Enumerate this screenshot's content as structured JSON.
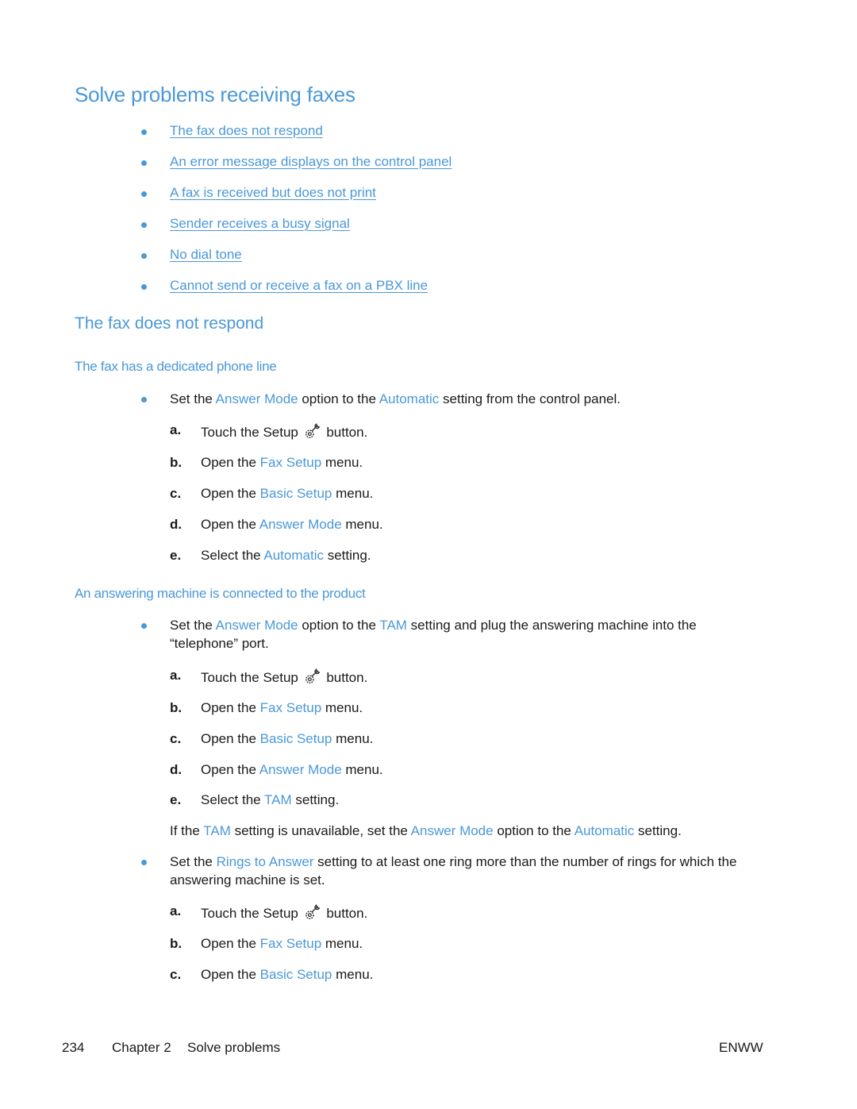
{
  "title": "Solve problems receiving faxes",
  "toc": [
    "The fax does not respond",
    "An error message displays on the control panel",
    "A fax is received but does not print",
    "Sender receives a busy signal",
    "No dial tone",
    "Cannot send or receive a fax on a PBX line"
  ],
  "section": {
    "title": "The fax does not respond",
    "sub1": {
      "title": "The fax has a dedicated phone line",
      "bullet": {
        "t1": "Set the ",
        "k1": "Answer Mode",
        "t2": " option to the ",
        "k2": "Automatic",
        "t3": " setting from the control panel."
      },
      "steps": [
        {
          "label": "a.",
          "pre": "Touch the Setup ",
          "key": "",
          "post": " button."
        },
        {
          "label": "b.",
          "pre": "Open the ",
          "key": "Fax Setup",
          "post": " menu."
        },
        {
          "label": "c.",
          "pre": "Open the ",
          "key": "Basic Setup",
          "post": " menu."
        },
        {
          "label": "d.",
          "pre": "Open the ",
          "key": "Answer Mode",
          "post": " menu."
        },
        {
          "label": "e.",
          "pre": "Select the ",
          "key": "Automatic",
          "post": " setting."
        }
      ]
    },
    "sub2": {
      "title": "An answering machine is connected to the product",
      "bullet1": {
        "t1": "Set the ",
        "k1": "Answer Mode",
        "t2": " option to the ",
        "k2": "TAM",
        "t3": " setting and plug the answering machine into the “telephone” port."
      },
      "steps1": [
        {
          "label": "a.",
          "pre": "Touch the Setup ",
          "key": "",
          "post": " button."
        },
        {
          "label": "b.",
          "pre": "Open the ",
          "key": "Fax Setup",
          "post": " menu."
        },
        {
          "label": "c.",
          "pre": "Open the ",
          "key": "Basic Setup",
          "post": " menu."
        },
        {
          "label": "d.",
          "pre": "Open the ",
          "key": "Answer Mode",
          "post": " menu."
        },
        {
          "label": "e.",
          "pre": "Select the ",
          "key": "TAM",
          "post": " setting."
        }
      ],
      "note": {
        "t1": "If the ",
        "k1": "TAM",
        "t2": " setting is unavailable, set the ",
        "k2": "Answer Mode",
        "t3": " option to the ",
        "k3": "Automatic",
        "t4": " setting."
      },
      "bullet2": {
        "t1": "Set the ",
        "k1": "Rings to Answer",
        "t2": " setting to at least one ring more than the number of rings for which the answering machine is set."
      },
      "steps2": [
        {
          "label": "a.",
          "pre": "Touch the Setup ",
          "key": "",
          "post": " button."
        },
        {
          "label": "b.",
          "pre": "Open the ",
          "key": "Fax Setup",
          "post": " menu."
        },
        {
          "label": "c.",
          "pre": "Open the ",
          "key": "Basic Setup",
          "post": " menu."
        }
      ]
    }
  },
  "footer": {
    "page_number": "234",
    "chapter": "Chapter 2",
    "chapter_title": "Solve problems",
    "locale": "ENWW"
  },
  "icons": {
    "setup": "setup-wrench-gear-icon",
    "bullet": "bullet-dot-icon"
  },
  "colors": {
    "accent": "#4a98d8",
    "text": "#1a1a1a"
  }
}
